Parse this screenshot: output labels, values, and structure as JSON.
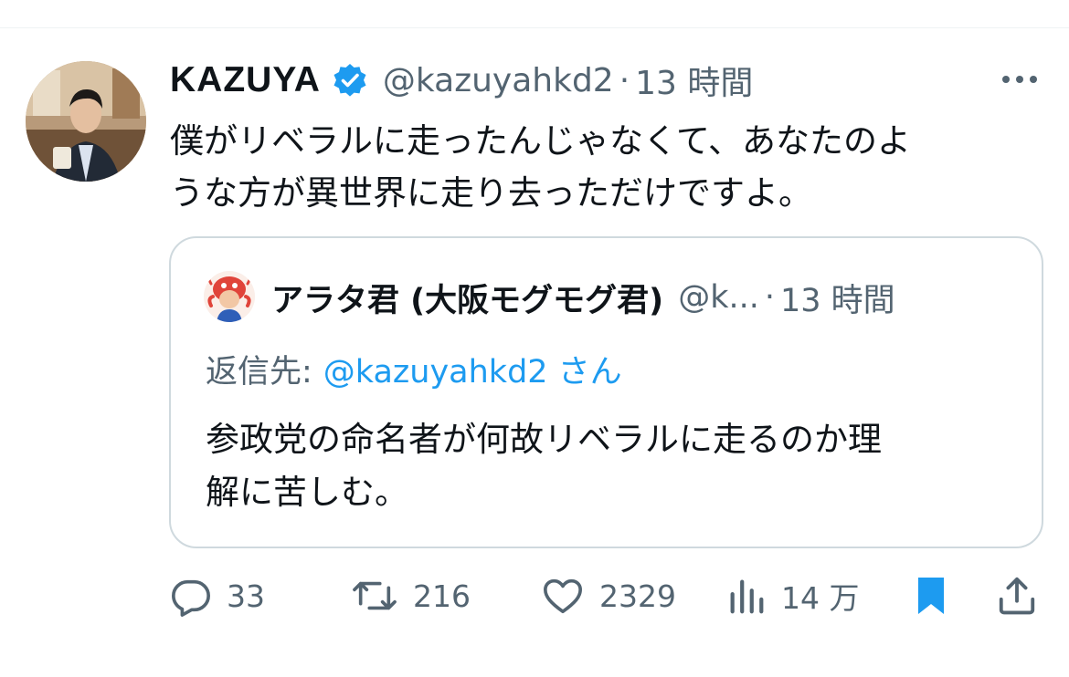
{
  "tweet": {
    "author": {
      "display_name": "KAZUYA",
      "verified": true,
      "handle": "@kazuyahkd2",
      "time": "13 時間"
    },
    "separator": "·",
    "text": "僕がリベラルに走ったんじゃなくて、あなたのよ\nうな方が異世界に走り去っただけですよ。"
  },
  "quote": {
    "author": {
      "display_name": "アラタ君 (大阪モグモグ君)",
      "handle": "@k...",
      "time": "13 時間"
    },
    "separator": "·",
    "reply_prefix": "返信先:",
    "reply_mention": "@kazuyahkd2 さん",
    "text": "参政党の命名者が何故リベラルに走るのか理\n解に苦しむ。"
  },
  "actions": {
    "replies": "33",
    "retweets": "216",
    "likes": "2329",
    "views": "14 万"
  },
  "colors": {
    "text_primary": "#0f1419",
    "text_secondary": "#536471",
    "accent": "#1d9bf0",
    "border": "#cfd9de"
  },
  "icons": {
    "verified": "verified-badge-icon",
    "more": "more-horizontal-icon",
    "reply": "reply-bubble-icon",
    "retweet": "retweet-icon",
    "like": "heart-icon",
    "views": "bar-chart-icon",
    "bookmark": "bookmark-filled-icon",
    "share": "share-upload-icon"
  }
}
